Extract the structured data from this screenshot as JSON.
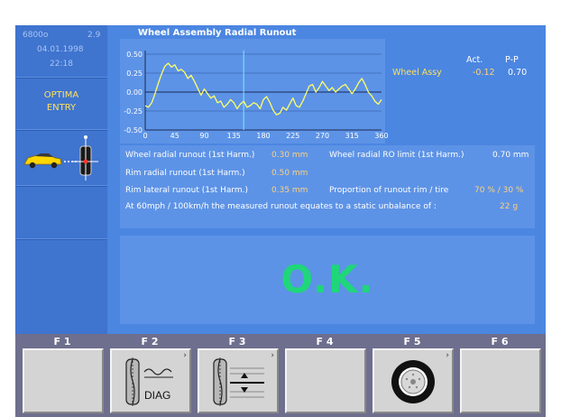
{
  "sidebar": {
    "code": "6800o",
    "version": "2.9",
    "date": "04.01.1998",
    "time": "22:18",
    "mode_line1": "OPTIMA",
    "mode_line2": "ENTRY"
  },
  "chart_data": {
    "type": "line",
    "title": "Wheel Assembly Radial Runout",
    "xlabel": "",
    "ylabel": "",
    "x_ticks": [
      "0",
      "45",
      "90",
      "135",
      "180",
      "225",
      "270",
      "315",
      "360"
    ],
    "y_ticks": [
      "0.50",
      "0.25",
      "0.00",
      "-0.25",
      "-0.50"
    ],
    "xlim": [
      0,
      360
    ],
    "ylim": [
      -0.5,
      0.5
    ],
    "marker_angle": 150,
    "series": [
      {
        "color": "#ffff66",
        "x": [
          0,
          5,
          10,
          15,
          20,
          25,
          30,
          35,
          40,
          45,
          50,
          55,
          60,
          65,
          70,
          75,
          80,
          85,
          90,
          95,
          100,
          105,
          110,
          115,
          120,
          125,
          130,
          135,
          140,
          145,
          150,
          155,
          160,
          165,
          170,
          175,
          180,
          185,
          190,
          195,
          200,
          205,
          210,
          215,
          220,
          225,
          230,
          235,
          240,
          245,
          250,
          255,
          260,
          265,
          270,
          275,
          280,
          285,
          290,
          295,
          300,
          305,
          310,
          315,
          320,
          325,
          330,
          335,
          340,
          345,
          350,
          355,
          360
        ],
        "y": [
          -0.18,
          -0.2,
          -0.14,
          -0.02,
          0.12,
          0.24,
          0.34,
          0.38,
          0.33,
          0.36,
          0.28,
          0.3,
          0.26,
          0.18,
          0.22,
          0.14,
          0.05,
          -0.04,
          0.04,
          -0.02,
          -0.08,
          -0.05,
          -0.14,
          -0.12,
          -0.2,
          -0.16,
          -0.1,
          -0.14,
          -0.22,
          -0.16,
          -0.12,
          -0.2,
          -0.18,
          -0.14,
          -0.16,
          -0.22,
          -0.1,
          -0.06,
          -0.14,
          -0.24,
          -0.3,
          -0.28,
          -0.2,
          -0.24,
          -0.16,
          -0.08,
          -0.18,
          -0.2,
          -0.12,
          -0.02,
          0.08,
          0.1,
          0.0,
          0.06,
          0.14,
          0.08,
          0.02,
          0.06,
          0.0,
          0.04,
          0.08,
          0.1,
          0.04,
          -0.02,
          0.04,
          0.12,
          0.18,
          0.1,
          0.0,
          -0.05,
          -0.12,
          -0.16,
          -0.1
        ]
      }
    ]
  },
  "assy": {
    "label": "Wheel Assy",
    "act_header": "Act.",
    "pp_header": "P-P",
    "act_value": "-0.12",
    "pp_value": "0.70"
  },
  "values": {
    "r1_label": "Wheel radial runout (1st Harm.)",
    "r1_value": "0.30 mm",
    "r1_label2": "Wheel radial RO limit (1st Harm.)",
    "r1_value2": "0.70 mm",
    "r2_label": "Rim radial runout (1st Harm.)",
    "r2_value": "0.50 mm",
    "r3_label": "Rim lateral runout (1st Harm.)",
    "r3_value": "0.35 mm",
    "r3_label2": "Proportion of runout rim / tire",
    "r3_value2": "70 % / 30 %",
    "r4_label": "At 60mph / 100km/h the measured runout equates to a static unbalance of :",
    "r4_value": "22 g"
  },
  "status": {
    "text": "O.K."
  },
  "fkeys": [
    {
      "label": "F 1"
    },
    {
      "label": "F 2",
      "icon_text": "DIAG"
    },
    {
      "label": "F 3"
    },
    {
      "label": "F 4"
    },
    {
      "label": "F 5"
    },
    {
      "label": "F 6"
    }
  ],
  "colors": {
    "sidebar": "#3f74cf",
    "panel": "#4b86e1",
    "ok": "#1fd67a",
    "trace": "#ffff66",
    "value": "#ffd27f"
  }
}
